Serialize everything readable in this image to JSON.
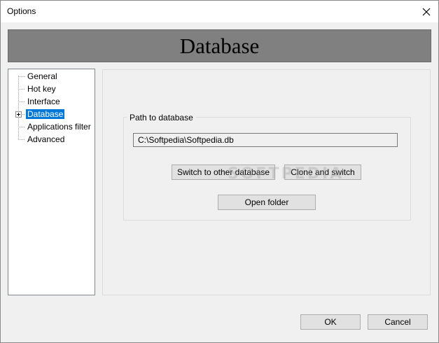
{
  "window": {
    "title": "Options"
  },
  "banner": {
    "title": "Database"
  },
  "tree": {
    "items": [
      {
        "label": "General",
        "selected": false
      },
      {
        "label": "Hot key",
        "selected": false
      },
      {
        "label": "Interface",
        "selected": false
      },
      {
        "label": "Database",
        "selected": true
      },
      {
        "label": "Applications filter",
        "selected": false
      },
      {
        "label": "Advanced",
        "selected": false
      }
    ]
  },
  "database": {
    "group_label": "Path to database",
    "path_value": "C:\\Softpedia\\Softpedia.db",
    "switch_label": "Switch to other database",
    "clone_label": "Clone and switch",
    "open_folder_label": "Open folder"
  },
  "watermark": "SOFTPEDIA",
  "footer": {
    "ok_label": "OK",
    "cancel_label": "Cancel"
  },
  "colors": {
    "selection": "#0078d7",
    "banner": "#808080"
  }
}
